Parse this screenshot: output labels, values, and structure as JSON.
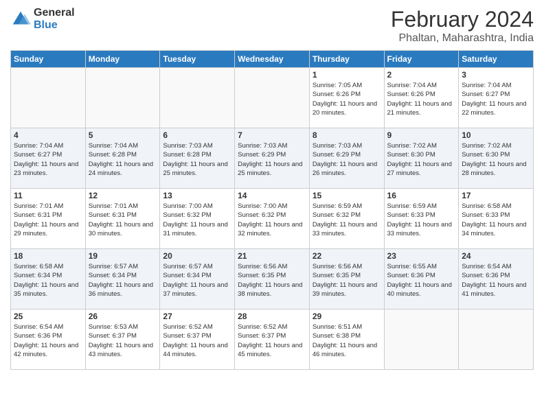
{
  "logo": {
    "general": "General",
    "blue": "Blue"
  },
  "title": {
    "month_year": "February 2024",
    "location": "Phaltan, Maharashtra, India"
  },
  "days_of_week": [
    "Sunday",
    "Monday",
    "Tuesday",
    "Wednesday",
    "Thursday",
    "Friday",
    "Saturday"
  ],
  "weeks": [
    [
      {
        "num": "",
        "sunrise": "",
        "sunset": "",
        "daylight": "",
        "empty": true
      },
      {
        "num": "",
        "sunrise": "",
        "sunset": "",
        "daylight": "",
        "empty": true
      },
      {
        "num": "",
        "sunrise": "",
        "sunset": "",
        "daylight": "",
        "empty": true
      },
      {
        "num": "",
        "sunrise": "",
        "sunset": "",
        "daylight": "",
        "empty": true
      },
      {
        "num": "1",
        "sunrise": "Sunrise: 7:05 AM",
        "sunset": "Sunset: 6:26 PM",
        "daylight": "Daylight: 11 hours and 20 minutes.",
        "empty": false
      },
      {
        "num": "2",
        "sunrise": "Sunrise: 7:04 AM",
        "sunset": "Sunset: 6:26 PM",
        "daylight": "Daylight: 11 hours and 21 minutes.",
        "empty": false
      },
      {
        "num": "3",
        "sunrise": "Sunrise: 7:04 AM",
        "sunset": "Sunset: 6:27 PM",
        "daylight": "Daylight: 11 hours and 22 minutes.",
        "empty": false
      }
    ],
    [
      {
        "num": "4",
        "sunrise": "Sunrise: 7:04 AM",
        "sunset": "Sunset: 6:27 PM",
        "daylight": "Daylight: 11 hours and 23 minutes.",
        "empty": false
      },
      {
        "num": "5",
        "sunrise": "Sunrise: 7:04 AM",
        "sunset": "Sunset: 6:28 PM",
        "daylight": "Daylight: 11 hours and 24 minutes.",
        "empty": false
      },
      {
        "num": "6",
        "sunrise": "Sunrise: 7:03 AM",
        "sunset": "Sunset: 6:28 PM",
        "daylight": "Daylight: 11 hours and 25 minutes.",
        "empty": false
      },
      {
        "num": "7",
        "sunrise": "Sunrise: 7:03 AM",
        "sunset": "Sunset: 6:29 PM",
        "daylight": "Daylight: 11 hours and 25 minutes.",
        "empty": false
      },
      {
        "num": "8",
        "sunrise": "Sunrise: 7:03 AM",
        "sunset": "Sunset: 6:29 PM",
        "daylight": "Daylight: 11 hours and 26 minutes.",
        "empty": false
      },
      {
        "num": "9",
        "sunrise": "Sunrise: 7:02 AM",
        "sunset": "Sunset: 6:30 PM",
        "daylight": "Daylight: 11 hours and 27 minutes.",
        "empty": false
      },
      {
        "num": "10",
        "sunrise": "Sunrise: 7:02 AM",
        "sunset": "Sunset: 6:30 PM",
        "daylight": "Daylight: 11 hours and 28 minutes.",
        "empty": false
      }
    ],
    [
      {
        "num": "11",
        "sunrise": "Sunrise: 7:01 AM",
        "sunset": "Sunset: 6:31 PM",
        "daylight": "Daylight: 11 hours and 29 minutes.",
        "empty": false
      },
      {
        "num": "12",
        "sunrise": "Sunrise: 7:01 AM",
        "sunset": "Sunset: 6:31 PM",
        "daylight": "Daylight: 11 hours and 30 minutes.",
        "empty": false
      },
      {
        "num": "13",
        "sunrise": "Sunrise: 7:00 AM",
        "sunset": "Sunset: 6:32 PM",
        "daylight": "Daylight: 11 hours and 31 minutes.",
        "empty": false
      },
      {
        "num": "14",
        "sunrise": "Sunrise: 7:00 AM",
        "sunset": "Sunset: 6:32 PM",
        "daylight": "Daylight: 11 hours and 32 minutes.",
        "empty": false
      },
      {
        "num": "15",
        "sunrise": "Sunrise: 6:59 AM",
        "sunset": "Sunset: 6:32 PM",
        "daylight": "Daylight: 11 hours and 33 minutes.",
        "empty": false
      },
      {
        "num": "16",
        "sunrise": "Sunrise: 6:59 AM",
        "sunset": "Sunset: 6:33 PM",
        "daylight": "Daylight: 11 hours and 33 minutes.",
        "empty": false
      },
      {
        "num": "17",
        "sunrise": "Sunrise: 6:58 AM",
        "sunset": "Sunset: 6:33 PM",
        "daylight": "Daylight: 11 hours and 34 minutes.",
        "empty": false
      }
    ],
    [
      {
        "num": "18",
        "sunrise": "Sunrise: 6:58 AM",
        "sunset": "Sunset: 6:34 PM",
        "daylight": "Daylight: 11 hours and 35 minutes.",
        "empty": false
      },
      {
        "num": "19",
        "sunrise": "Sunrise: 6:57 AM",
        "sunset": "Sunset: 6:34 PM",
        "daylight": "Daylight: 11 hours and 36 minutes.",
        "empty": false
      },
      {
        "num": "20",
        "sunrise": "Sunrise: 6:57 AM",
        "sunset": "Sunset: 6:34 PM",
        "daylight": "Daylight: 11 hours and 37 minutes.",
        "empty": false
      },
      {
        "num": "21",
        "sunrise": "Sunrise: 6:56 AM",
        "sunset": "Sunset: 6:35 PM",
        "daylight": "Daylight: 11 hours and 38 minutes.",
        "empty": false
      },
      {
        "num": "22",
        "sunrise": "Sunrise: 6:56 AM",
        "sunset": "Sunset: 6:35 PM",
        "daylight": "Daylight: 11 hours and 39 minutes.",
        "empty": false
      },
      {
        "num": "23",
        "sunrise": "Sunrise: 6:55 AM",
        "sunset": "Sunset: 6:36 PM",
        "daylight": "Daylight: 11 hours and 40 minutes.",
        "empty": false
      },
      {
        "num": "24",
        "sunrise": "Sunrise: 6:54 AM",
        "sunset": "Sunset: 6:36 PM",
        "daylight": "Daylight: 11 hours and 41 minutes.",
        "empty": false
      }
    ],
    [
      {
        "num": "25",
        "sunrise": "Sunrise: 6:54 AM",
        "sunset": "Sunset: 6:36 PM",
        "daylight": "Daylight: 11 hours and 42 minutes.",
        "empty": false
      },
      {
        "num": "26",
        "sunrise": "Sunrise: 6:53 AM",
        "sunset": "Sunset: 6:37 PM",
        "daylight": "Daylight: 11 hours and 43 minutes.",
        "empty": false
      },
      {
        "num": "27",
        "sunrise": "Sunrise: 6:52 AM",
        "sunset": "Sunset: 6:37 PM",
        "daylight": "Daylight: 11 hours and 44 minutes.",
        "empty": false
      },
      {
        "num": "28",
        "sunrise": "Sunrise: 6:52 AM",
        "sunset": "Sunset: 6:37 PM",
        "daylight": "Daylight: 11 hours and 45 minutes.",
        "empty": false
      },
      {
        "num": "29",
        "sunrise": "Sunrise: 6:51 AM",
        "sunset": "Sunset: 6:38 PM",
        "daylight": "Daylight: 11 hours and 46 minutes.",
        "empty": false
      },
      {
        "num": "",
        "sunrise": "",
        "sunset": "",
        "daylight": "",
        "empty": true
      },
      {
        "num": "",
        "sunrise": "",
        "sunset": "",
        "daylight": "",
        "empty": true
      }
    ]
  ]
}
